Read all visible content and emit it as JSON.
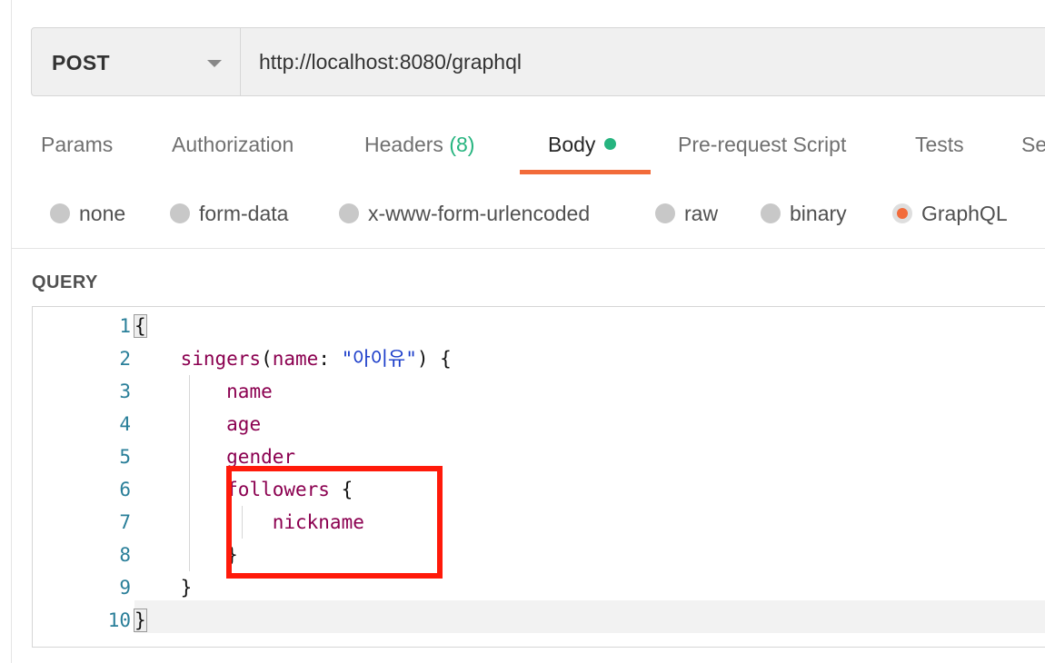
{
  "request": {
    "method": "POST",
    "url": "http://localhost:8080/graphql"
  },
  "tabs": [
    {
      "label": "Params"
    },
    {
      "label": "Authorization"
    },
    {
      "label": "Headers",
      "count": "(8)"
    },
    {
      "label": "Body",
      "active": true
    },
    {
      "label": "Pre-request Script"
    },
    {
      "label": "Tests"
    },
    {
      "label": "Se"
    }
  ],
  "body_types": [
    {
      "label": "none"
    },
    {
      "label": "form-data"
    },
    {
      "label": "x-www-form-urlencoded"
    },
    {
      "label": "raw"
    },
    {
      "label": "binary"
    },
    {
      "label": "GraphQL",
      "selected": true
    }
  ],
  "query_label": "QUERY",
  "editor": {
    "line_numbers": [
      "1",
      "2",
      "3",
      "4",
      "5",
      "6",
      "7",
      "8",
      "9",
      "10"
    ],
    "lines": {
      "l1": "{",
      "l2_fn": "singers",
      "l2_open": "(",
      "l2_arg": "name",
      "l2_colon": ": ",
      "l2_str": "\"아이유\"",
      "l2_close": ") {",
      "l3": "name",
      "l4": "age",
      "l5": "gender",
      "l6_field": "followers",
      "l6_brace": " {",
      "l7": "nickname",
      "l8": "}",
      "l9": "}",
      "l10": "}"
    }
  },
  "colors": {
    "accent": "#f26b3a",
    "success": "#26b47f",
    "highlight": "#ff1a0a",
    "keyword": "#8b0050",
    "string": "#1a3cc9",
    "line_number": "#2a7f99"
  }
}
